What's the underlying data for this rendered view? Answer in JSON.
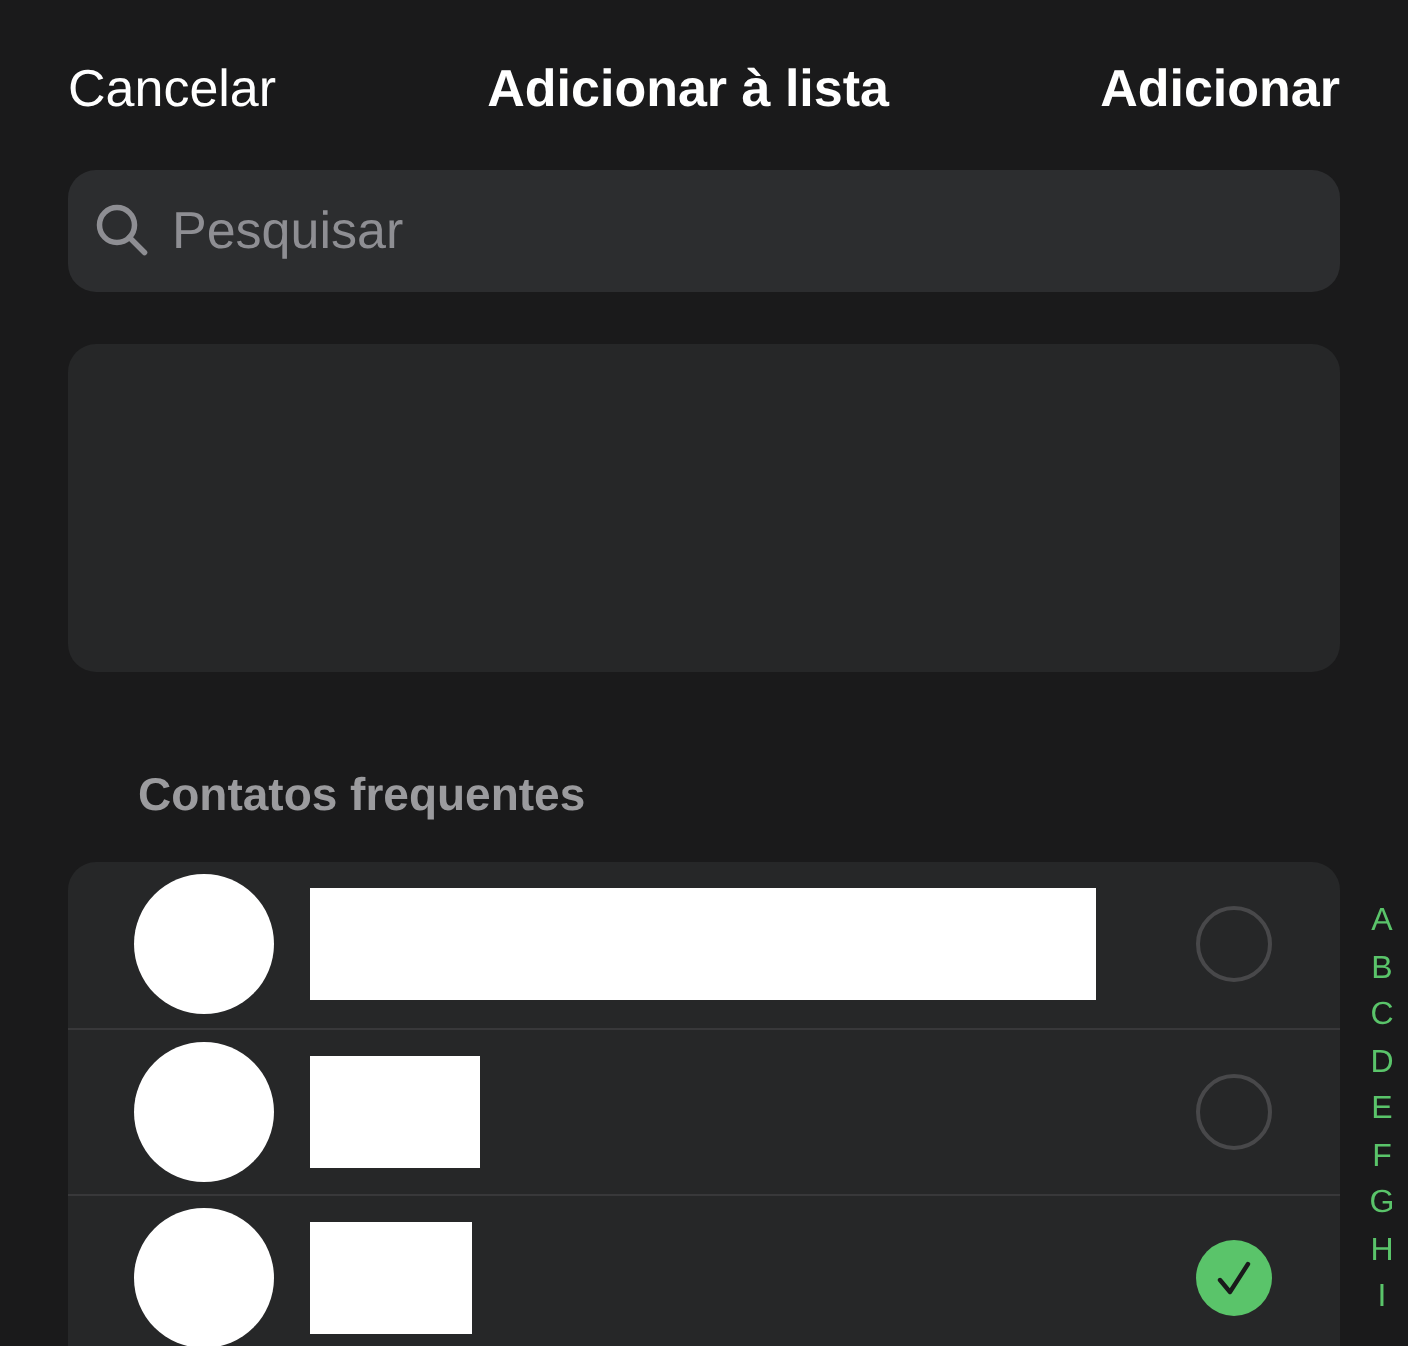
{
  "header": {
    "cancel": "Cancelar",
    "title": "Adicionar à lista",
    "confirm": "Adicionar"
  },
  "search": {
    "placeholder": "Pesquisar"
  },
  "section": {
    "title": "Contatos frequentes"
  },
  "contacts": [
    {
      "selected": false
    },
    {
      "selected": false
    },
    {
      "selected": true
    }
  ],
  "index": [
    "A",
    "B",
    "C",
    "D",
    "E",
    "F",
    "G",
    "H",
    "I"
  ]
}
